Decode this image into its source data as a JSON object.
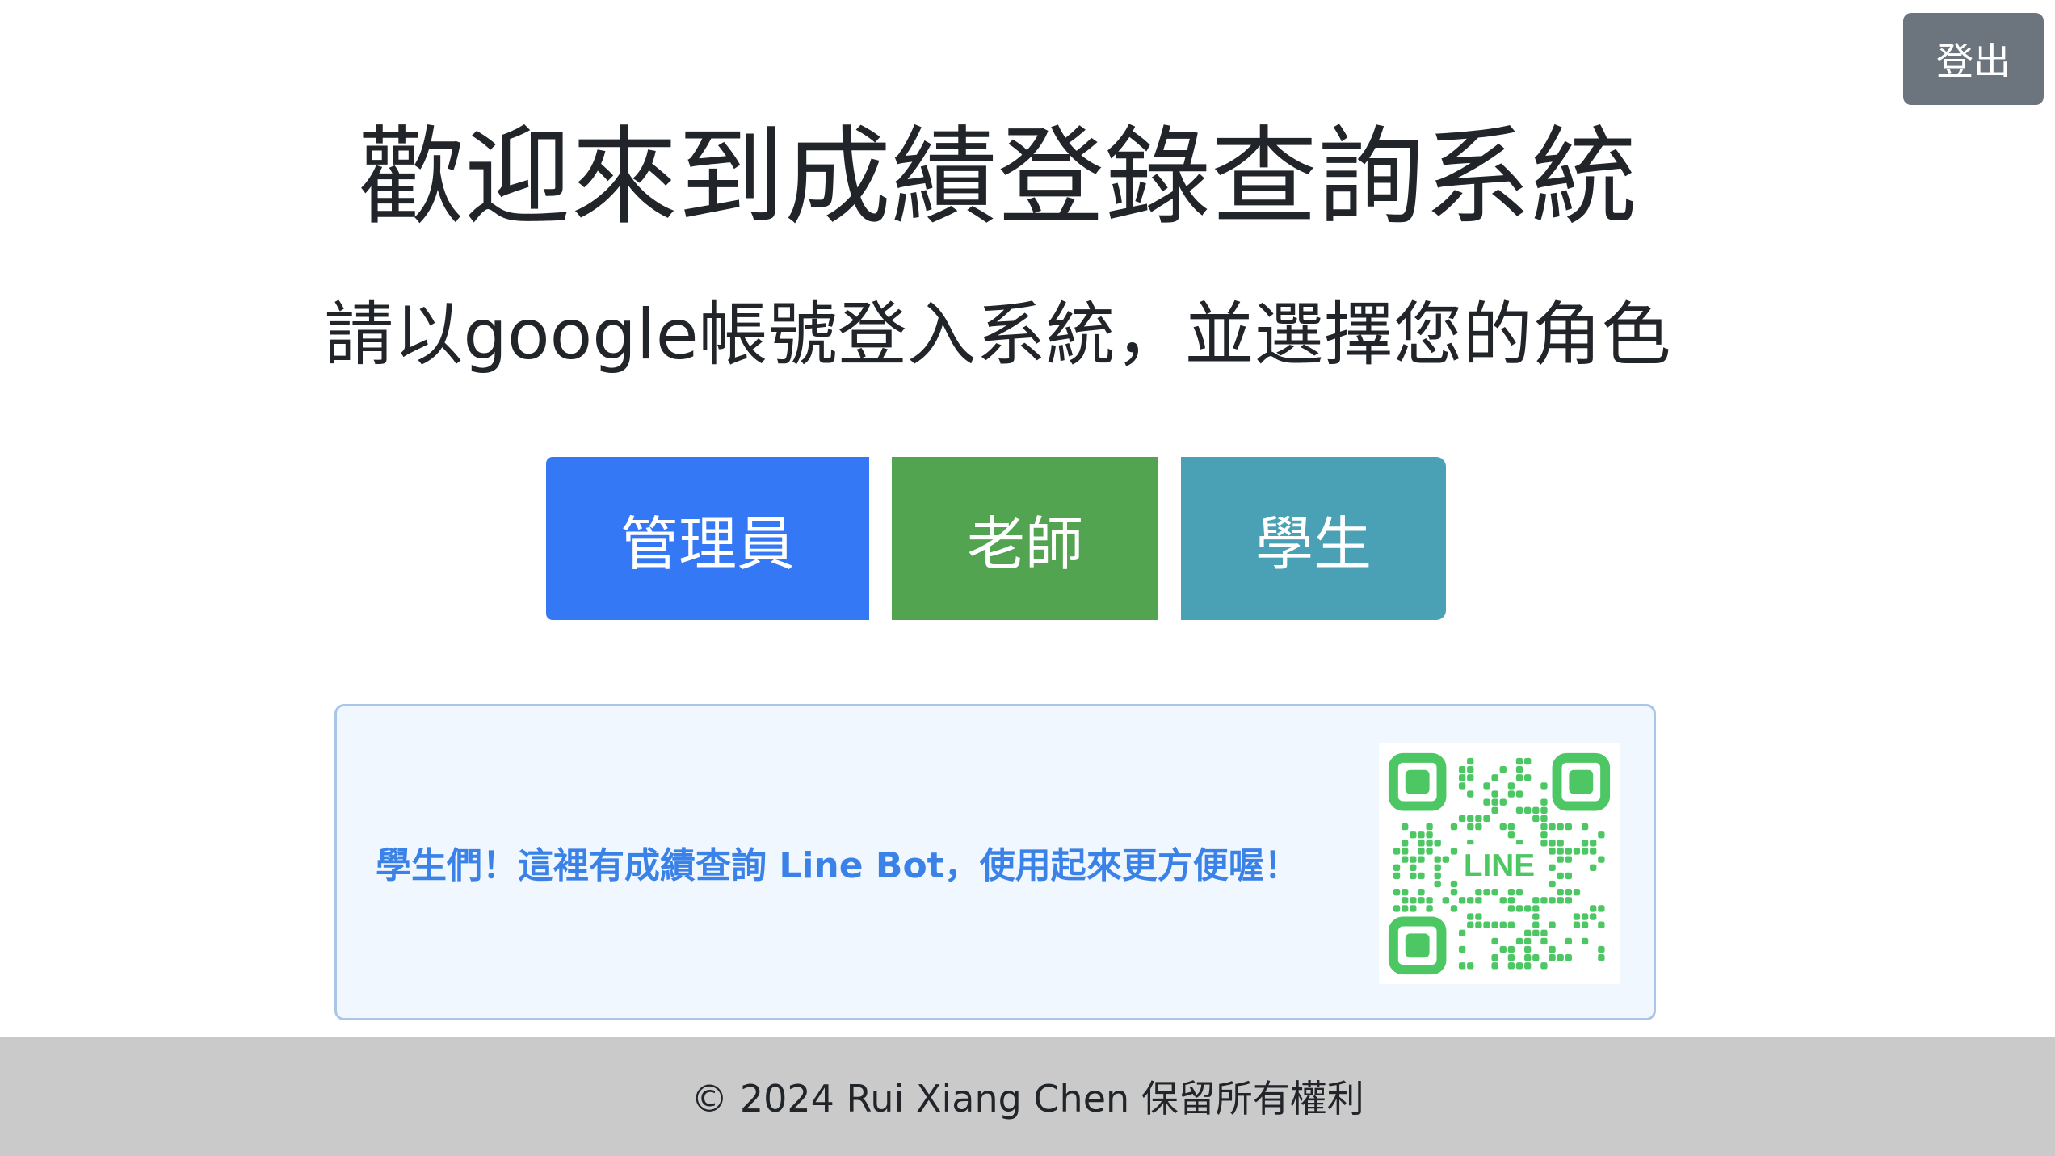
{
  "header": {
    "logout_label": "登出"
  },
  "main": {
    "title": "歡迎來到成績登錄查詢系統",
    "subtitle": "請以google帳號登入系統，並選擇您的角色",
    "roles": [
      {
        "label": "管理員",
        "color": "#3478f6"
      },
      {
        "label": "老師",
        "color": "#53a451"
      },
      {
        "label": "學生",
        "color": "#4aa0b5"
      }
    ]
  },
  "promo": {
    "text": "學生們！這裡有成績查詢 Line Bot，使用起來更方便喔！",
    "qr_label": "LINE",
    "qr_color": "#4cc764"
  },
  "footer": {
    "text": "© 2024 Rui Xiang Chen 保留所有權利"
  }
}
